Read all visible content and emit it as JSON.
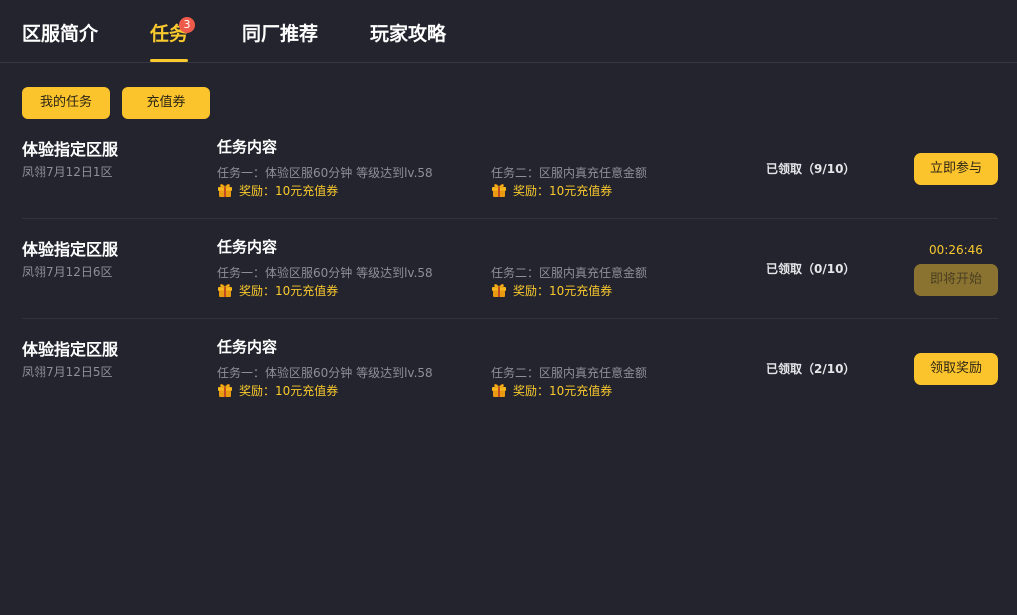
{
  "tabs": [
    {
      "label": "区服简介"
    },
    {
      "label": "任务",
      "badge": "3"
    },
    {
      "label": "同厂推荐"
    },
    {
      "label": "玩家攻略"
    }
  ],
  "sub_tabs": [
    {
      "label": "我的任务"
    },
    {
      "label": "充值券"
    }
  ],
  "rows": [
    {
      "server_title": "体验指定区服",
      "server_sub": "凤翎7月12日1区",
      "content_title": "任务内容",
      "task1": "任务一：体验区服60分钟   等级达到lv.58",
      "task1_reward": "奖励：10元充值券",
      "task2": "任务二：区服内真充任意金额",
      "task2_reward": "奖励：10元充值券",
      "claimed": "已领取（9/10）",
      "action": "立即参与"
    },
    {
      "server_title": "体验指定区服",
      "server_sub": "凤翎7月12日6区",
      "content_title": "任务内容",
      "task1": "任务一：体验区服60分钟   等级达到lv.58",
      "task1_reward": "奖励：10元充值券",
      "task2": "任务二：区服内真充任意金额",
      "task2_reward": "奖励：10元充值券",
      "claimed": "已领取（0/10）",
      "timer": "00:26:46",
      "action": "即将开始"
    },
    {
      "server_title": "体验指定区服",
      "server_sub": "凤翎7月12日5区",
      "content_title": "任务内容",
      "task1": "任务一：体验区服60分钟   等级达到lv.58",
      "task1_reward": "奖励：10元充值券",
      "task2": "任务二：区服内真充任意金额",
      "task2_reward": "奖励：10元充值券",
      "claimed": "已领取（2/10）",
      "action": "领取奖励"
    }
  ],
  "colors": {
    "background": "#23242e",
    "accent": "#f9c92d",
    "button": "#fcc42c",
    "badge": "#ef5b4b"
  },
  "icons": {
    "reward": "gift-icon"
  }
}
